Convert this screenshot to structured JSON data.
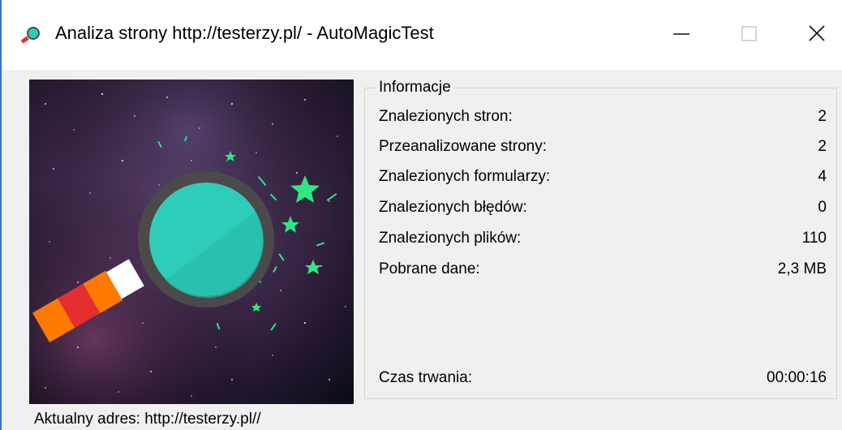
{
  "window": {
    "title": "Analiza strony http://testerzy.pl/ - AutoMagicTest",
    "app_icon": "magnifier-icon",
    "controls": [
      "minimize-icon",
      "maximize-icon",
      "close-icon"
    ]
  },
  "image": {
    "description_icon": "magnifying-glass-illustration",
    "colors": {
      "lens": "#2ecdb9",
      "rim": "#4a4a4a",
      "handle_red": "#e62e2e",
      "handle_orange": "#ff7a00",
      "stars": "#2ee882"
    }
  },
  "info": {
    "group_title": "Informacje",
    "rows": [
      {
        "label": "Znalezionych stron:",
        "value": "2"
      },
      {
        "label": "Przeanalizowane strony:",
        "value": "2"
      },
      {
        "label": "Znalezionych formularzy:",
        "value": "4"
      },
      {
        "label": "Znalezionych błędów:",
        "value": "0"
      },
      {
        "label": "Znalezionych plików:",
        "value": "110"
      },
      {
        "label": "Pobrane dane:",
        "value": "2,3 MB"
      }
    ],
    "duration": {
      "label": "Czas trwania:",
      "value": "00:00:16"
    }
  },
  "status": {
    "current_address": "Aktualny adres: http://testerzy.pl//"
  }
}
